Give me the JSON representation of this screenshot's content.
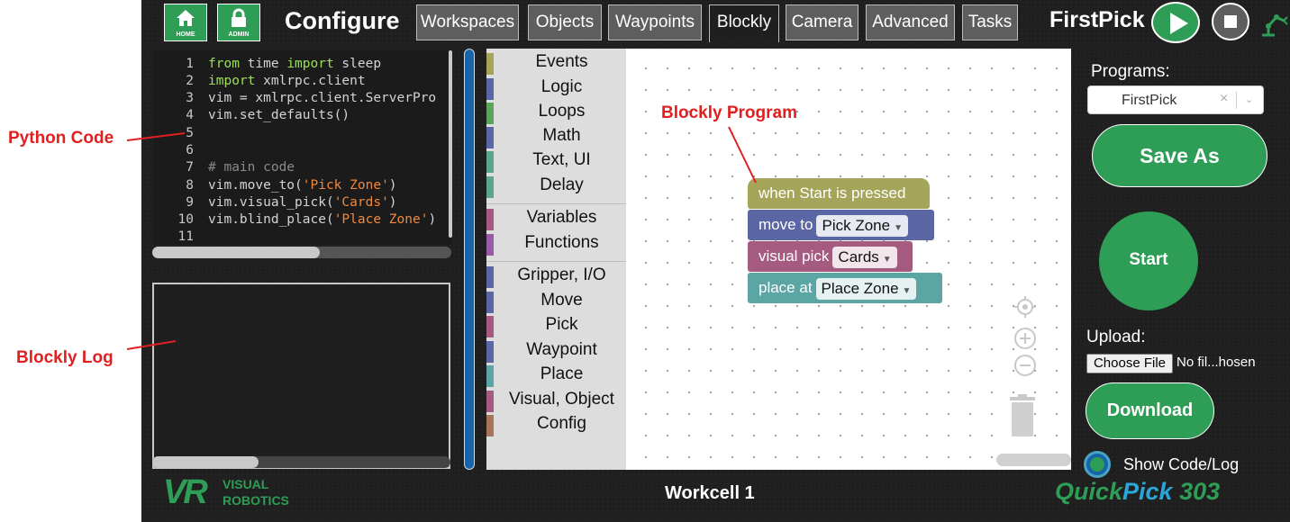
{
  "annotations": {
    "python_code": "Python Code",
    "blockly_log": "Blockly Log",
    "blockly_program": "Blockly Program"
  },
  "header": {
    "home_label": "HOME",
    "admin_label": "ADMIN",
    "page_title": "Configure",
    "tabs": [
      {
        "label": "Workspaces",
        "active": false
      },
      {
        "label": "Objects",
        "active": false
      },
      {
        "label": "Waypoints",
        "active": false
      },
      {
        "label": "Blockly",
        "active": true
      },
      {
        "label": "Camera",
        "active": false
      },
      {
        "label": "Advanced",
        "active": false
      },
      {
        "label": "Tasks",
        "active": false
      }
    ],
    "program_name": "FirstPick"
  },
  "code": {
    "lines": [
      {
        "n": "1",
        "text": "from time import sleep"
      },
      {
        "n": "2",
        "text": "import xmlrpc.client"
      },
      {
        "n": "3",
        "text": "vim = xmlrpc.client.ServerPro"
      },
      {
        "n": "4",
        "text": "vim.set_defaults()"
      },
      {
        "n": "5",
        "text": ""
      },
      {
        "n": "6",
        "text": ""
      },
      {
        "n": "7",
        "text": "# main code"
      },
      {
        "n": "8",
        "text": "vim.move_to('Pick Zone')"
      },
      {
        "n": "9",
        "text": "vim.visual_pick('Cards')"
      },
      {
        "n": "10",
        "text": "vim.blind_place('Place Zone')"
      },
      {
        "n": "11",
        "text": ""
      }
    ]
  },
  "toolbox": {
    "categories": [
      {
        "label": "Events",
        "color": "#a5a55a"
      },
      {
        "label": "Logic",
        "color": "#5b67a5"
      },
      {
        "label": "Loops",
        "color": "#5ba55b"
      },
      {
        "label": "Math",
        "color": "#5b67a5"
      },
      {
        "label": "Text, UI",
        "color": "#5ba58c"
      },
      {
        "label": "Delay",
        "color": "#5ba58c"
      },
      {
        "label": "Variables",
        "color": "#a55b80"
      },
      {
        "label": "Functions",
        "color": "#995ba5"
      },
      {
        "label": "Gripper, I/O",
        "color": "#5b67a5"
      },
      {
        "label": "Move",
        "color": "#5b67a5"
      },
      {
        "label": "Pick",
        "color": "#a55b80"
      },
      {
        "label": "Waypoint",
        "color": "#5b67a5"
      },
      {
        "label": "Place",
        "color": "#5ba5a5"
      },
      {
        "label": "Visual, Object",
        "color": "#a55b80"
      },
      {
        "label": "Config",
        "color": "#a5745b"
      }
    ]
  },
  "blocks": {
    "event": {
      "text": "when Start is pressed",
      "color": "#a5a55a"
    },
    "move": {
      "text": "move to",
      "value": "Pick Zone",
      "color": "#5b67a5"
    },
    "pick": {
      "text": "visual pick",
      "value": "Cards",
      "color": "#a55b80"
    },
    "place": {
      "text": "place at",
      "value": "Place Zone",
      "color": "#5ba5a5"
    }
  },
  "right": {
    "programs_label": "Programs:",
    "program_selected": "FirstPick",
    "save_as": "Save As",
    "start": "Start",
    "upload_label": "Upload:",
    "choose_file": "Choose File",
    "file_status": "No fil...hosen",
    "download": "Download",
    "show_code_log": "Show Code/Log"
  },
  "footer": {
    "workcell": "Workcell 1",
    "brand_vr": "VR",
    "brand_visual": "VISUAL",
    "brand_robotics": "ROBOTICS",
    "product_quick": "Quick",
    "product_pick": "Pick",
    "product_num": " 303"
  },
  "colors": {
    "accent_green": "#2e9d55",
    "app_bg": "#1f1f1f",
    "annotation_red": "#e02020",
    "scroll_blue": "#1565a8"
  }
}
